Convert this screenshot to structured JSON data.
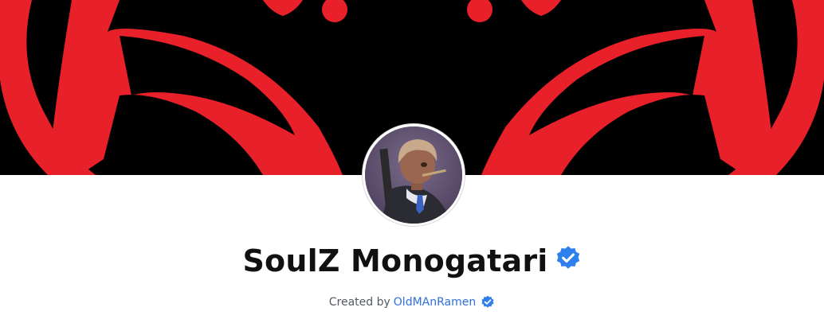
{
  "collection": {
    "title": "SoulZ Monogatari",
    "verified": true,
    "banner_icon": "red-mask-icon",
    "avatar_icon": "anime-character-avatar"
  },
  "creator": {
    "prefix": "Created by",
    "name": "OldMAnRamen",
    "verified": true
  },
  "colors": {
    "banner_background": "#000000",
    "banner_accent": "#e8202a",
    "verified_badge": "#2f80ed",
    "link": "#2f6fde",
    "title_text": "#111111"
  }
}
